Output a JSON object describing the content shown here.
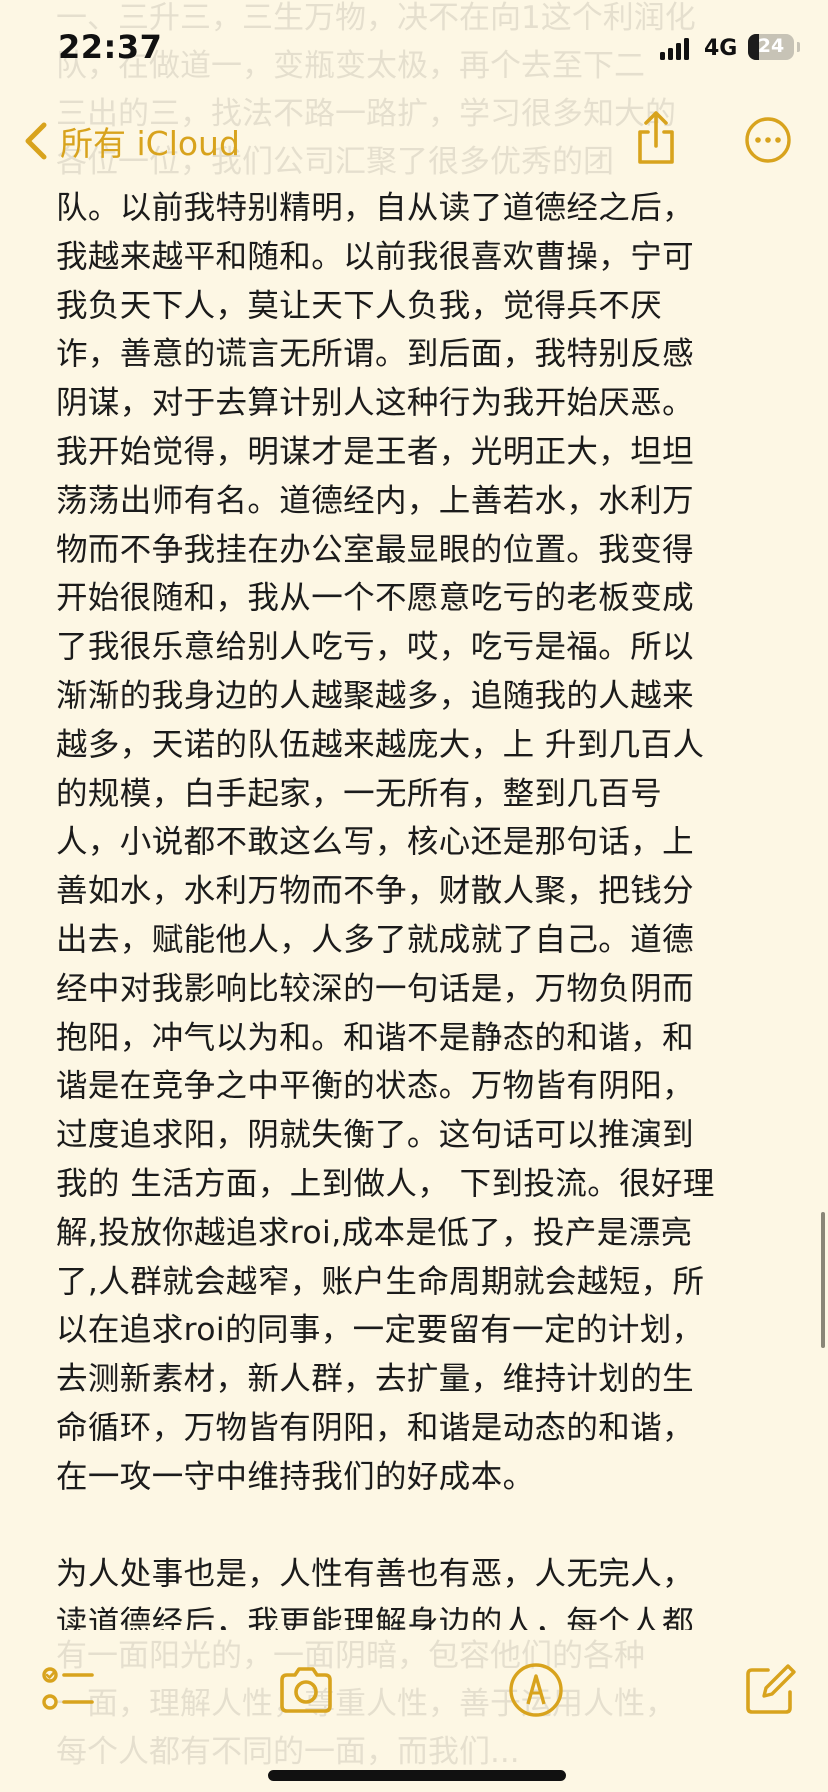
{
  "status_bar": {
    "time": "22:37",
    "network": "4G",
    "battery": "24",
    "battery_fraction": 0.24,
    "icons": [
      "signal-bars-icon",
      "battery-icon"
    ]
  },
  "nav": {
    "back_label": "所有 iCloud",
    "icons": [
      "chevron-left-icon",
      "share-icon",
      "more-icon"
    ]
  },
  "accent_color": "#d8a31d",
  "background_color": "#fdf7e4",
  "ghost_top_text": "一、三升三，三生万物，决不在向1这个利润化\n队，在做道一，变瓶变太极，再个去至下二\n三出的三，找法不路一路扩，学习很多知大的\n各位一位，我们公司汇聚了很多优秀的团",
  "note": {
    "paragraph_1": "队。以前我特别精明，自从读了道德经之后，\n我越来越平和随和。以前我很喜欢曹操，宁可\n我负天下人，莫让天下人负我，觉得兵不厌\n诈，善意的谎言无所谓。到后面，我特别反感\n阴谋，对于去算计别人这种行为我开始厌恶。\n我开始觉得，明谋才是王者，光明正大，坦坦\n荡荡出师有名。道德经内，上善若水，水利万\n物而不争我挂在办公室最显眼的位置。我变得\n开始很随和，我从一个不愿意吃亏的老板变成\n了我很乐意给别人吃亏，哎，吃亏是福。所以\n渐渐的我身边的人越聚越多，追随我的人越来\n越多，天诺的队伍越来越庞大，上 升到几百人\n的规模，白手起家，一无所有，整到几百号\n人，小说都不敢这么写，核心还是那句话，上\n善如水，水利万物而不争，财散人聚，把钱分\n出去，赋能他人，人多了就成就了自己。道德\n经中对我影响比较深的一句话是，万物负阴而\n抱阳，冲气以为和。和谐不是静态的和谐，和\n谐是在竞争之中平衡的状态。万物皆有阴阳，\n过度追求阳，阴就失衡了。这句话可以推演到\n我的 生活方面，上到做人， 下到投流。很好理\n解,投放你越追求roi,成本是低了，投产是漂亮\n了,人群就会越窄，账户生命周期就会越短，所\n以在追求roi的同事，一定要留有一定的计划，\n去测新素材，新人群，去扩量，维持计划的生\n命循环，万物皆有阴阳，和谐是动态的和谐，\n在一攻一守中维持我们的好成本。",
    "paragraph_2": "为人处事也是，人性有善也有恶，人无完人，\n读道德经后，我更能理解身边的人，每个人都"
  },
  "ghost_bottom_text": "有一面阳光的，一面阴暗，包容他们的各种\n一面，理解人性，尊重人性，善于运用人性，\n每个人都有不同的一面，而我们..."
}
